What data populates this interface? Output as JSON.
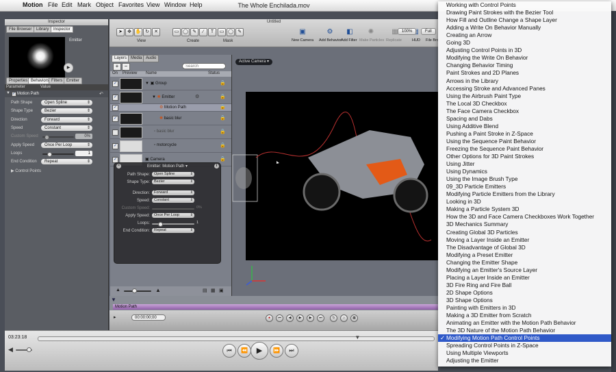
{
  "menubar": {
    "app_name": "Motion",
    "items": [
      "File",
      "Edit",
      "Mark",
      "Object",
      "Favorites",
      "View",
      "Window",
      "Help"
    ]
  },
  "movie_window": {
    "title": "The Whole Enchilada.mov"
  },
  "inspector": {
    "title": "Inspector",
    "top_tabs": [
      "File Browser",
      "Library",
      "Inspector"
    ],
    "preview_label": "Emitter",
    "tabs": [
      "Properties",
      "Behaviors",
      "Filters",
      "Emitter"
    ],
    "columns": {
      "parameter": "Parameter",
      "value": "Value"
    },
    "section": "Motion Path",
    "rows": [
      {
        "label": "Path Shape",
        "value": "Open Spline"
      },
      {
        "label": "Shape Type",
        "value": "Bezier"
      },
      {
        "label": "Direction",
        "value": "Forward"
      },
      {
        "label": "Speed",
        "value": "Constant"
      },
      {
        "label": "Custom Speed",
        "value": "0%"
      },
      {
        "label": "Apply Speed",
        "value": "Once Per Loop"
      },
      {
        "label": "Loops",
        "value": "1"
      },
      {
        "label": "End Condition",
        "value": "Repeat"
      }
    ],
    "control_points": "Control Points"
  },
  "canvas_window": {
    "title": "Untitled",
    "toolbar_groups": {
      "view": "View",
      "create": "Create",
      "mask": "Mask"
    },
    "toolbar_buttons": [
      {
        "label": "New Camera",
        "enabled": true
      },
      {
        "label": "Add Behavior",
        "enabled": true
      },
      {
        "label": "Add Filter",
        "enabled": true
      },
      {
        "label": "Make Particles",
        "enabled": false
      },
      {
        "label": "Replicate",
        "enabled": false
      },
      {
        "label": "HUD",
        "enabled": true
      },
      {
        "label": "File Bro",
        "enabled": true
      }
    ],
    "zoom": "100%",
    "render": "Full",
    "active_camera": "Active Camera"
  },
  "layers": {
    "tabs": [
      "Layers",
      "Media",
      "Audio"
    ],
    "search_placeholder": "Search",
    "columns": {
      "on": "On",
      "preview": "Preview",
      "name": "Name",
      "status": "Status"
    },
    "rows": [
      {
        "name": "Group",
        "checked": true
      },
      {
        "name": "Emitter",
        "checked": true
      },
      {
        "name": "Motion Path",
        "checked": true
      },
      {
        "name": "basic blur",
        "checked": true
      },
      {
        "name": "basic blur",
        "checked": false
      },
      {
        "name": "motorcycle",
        "checked": true
      },
      {
        "name": "Camera",
        "checked": true
      }
    ]
  },
  "hud": {
    "title": "Emitter: Motion Path",
    "rows": [
      {
        "label": "Path Shape:",
        "value": "Open Spline"
      },
      {
        "label": "Shape Type:",
        "value": "Bezier"
      },
      {
        "label": "Direction:",
        "value": "Forward"
      },
      {
        "label": "Speed:",
        "value": "Constant"
      },
      {
        "label": "Custom Speed:",
        "value": "0%"
      },
      {
        "label": "Apply Speed:",
        "value": "Once Per Loop"
      },
      {
        "label": "Loops:",
        "value": "1"
      },
      {
        "label": "End Condition:",
        "value": "Repeat"
      }
    ]
  },
  "timeline": {
    "bar_label": "Motion Path",
    "timecode": "00:00:00;00"
  },
  "quicktime": {
    "time": "03:23:18",
    "playhead_fraction": 0.8
  },
  "menu": {
    "items": [
      "Working with Control Points",
      "Drawing Paint Strokes with the Bezier Tool",
      "How Fill and Outline Change a Shape Layer",
      "Adding a Write On Behavior Manually",
      "Creating an Arrow",
      "Going 3D",
      "Adjusting Control Points in 3D",
      "Modifying the Write On Behavior",
      "Changing Behavior Timing",
      "Paint Strokes and 2D Planes",
      "Arrows in the Library",
      "Accessing Stroke and Advanced Panes",
      "Using the Airbrush Paint Type",
      "The Local 3D Checkbox",
      "The Face Camera Checkbox",
      "Spacing and Dabs",
      "Using Additive Blend",
      "Pushing a Paint Stroke in Z-Space",
      "Using the Sequence Paint Behavior",
      "Freezing the Sequence Paint Behavior",
      "Other Options for 3D Paint Strokes",
      "Using Jitter",
      "Using Dynamics",
      "Using the Image Brush Type",
      "09_3D Particle Emitters",
      "Modifying Particle Emitters from the Library",
      "Looking in 3D",
      "Making a Particle System 3D",
      "How the 3D and Face Camera Checkboxes Work Together",
      "3D Mechanics Summary",
      "Creating Global 3D Particles",
      "Moving a Layer Inside an Emitter",
      "The Disadvantage of Global 3D",
      "Modifying a Preset Emitter",
      "Changing the Emitter Shape",
      "Modifying an Emitter's Source Layer",
      "Placing a Layer Inside an Emitter",
      "3D Fire Ring and Fire Ball",
      "2D Shape Options",
      "3D Shape Options",
      "Painting with Emitters in 3D",
      "Making a 3D Emitter from Scratch",
      "Animating an Emitter with the Motion Path Behavior",
      "The 3D Nature of the Motion Path Behavior",
      "Modifying Motion Path Control Points",
      "Spreading Control Points in Z-Space",
      "Using Multiple Viewports",
      "Adjusting the Emitter"
    ],
    "selected_index": 44,
    "check_mark": "✓"
  },
  "colors": {
    "menu_highlight": "#2f59c8",
    "timeline_bar": "#a47bbb",
    "motion_path": "#b8302f"
  }
}
